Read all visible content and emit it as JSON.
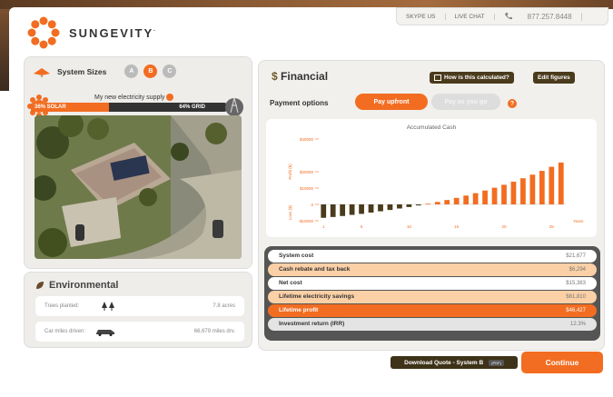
{
  "brand": {
    "name": "SUNGEVITY",
    "mark": "·"
  },
  "topbar": {
    "skype": "SKYPE US",
    "chat": "LIVE CHAT",
    "phone": "877.257.8448"
  },
  "system_sizes": {
    "label": "System Sizes",
    "options": [
      "A",
      "B",
      "C"
    ],
    "selected": "B"
  },
  "supply": {
    "title": "My new electricity supply",
    "solar": "36% SOLAR",
    "grid": "64% GRID"
  },
  "environmental": {
    "title": "Environmental",
    "rows": [
      {
        "label": "Trees planted:",
        "value": "7.8 acres"
      },
      {
        "label": "Car miles driven:",
        "value": "66,679 miles drv."
      }
    ]
  },
  "financial": {
    "title": "Financial",
    "how_label": "How is this calculated?",
    "edit_label": "Edit figures",
    "payment_label": "Payment options",
    "pay_upfront": "Pay upfront",
    "pay_as_you_go": "Pay as you go",
    "chart_title": "Accumulated Cash"
  },
  "chart_data": {
    "type": "bar",
    "title": "Accumulated Cash",
    "xlabel": "Years",
    "ylabel_pos": "Profit ($)",
    "ylabel_neg": "Loss ($)",
    "yticks": [
      "$40000",
      "$20000",
      "$10000",
      "0",
      "-$10000"
    ],
    "xticks": [
      "1",
      "5",
      "10",
      "15",
      "20",
      "25"
    ],
    "ylim": [
      -10000,
      40000
    ],
    "values": [
      -8200,
      -7700,
      -7100,
      -6400,
      -5800,
      -5000,
      -4200,
      -3400,
      -2500,
      -1600,
      -600,
      400,
      1500,
      2700,
      4000,
      5400,
      6900,
      8500,
      10200,
      12000,
      13900,
      16000,
      18200,
      20500,
      23000,
      25600
    ]
  },
  "table": {
    "rows": [
      {
        "label": "System cost",
        "value": "$21,677"
      },
      {
        "label": "Cash rebate and tax back",
        "value": "$6,294"
      },
      {
        "label": "Net cost",
        "value": "$15,383"
      },
      {
        "label": "Lifetime electricity savings",
        "value": "$61,810"
      },
      {
        "label": "Lifetime profit",
        "value": "$46,427"
      },
      {
        "label": "Investment return (IRR)",
        "value": "12.3%"
      }
    ]
  },
  "footer": {
    "download": "Download Quote - System B",
    "pdf": "(PDF)",
    "continue": "Continue"
  },
  "colors": {
    "accent": "#f26d21",
    "dark": "#4a3b1c",
    "neg_bar": "#4a3b1c"
  }
}
